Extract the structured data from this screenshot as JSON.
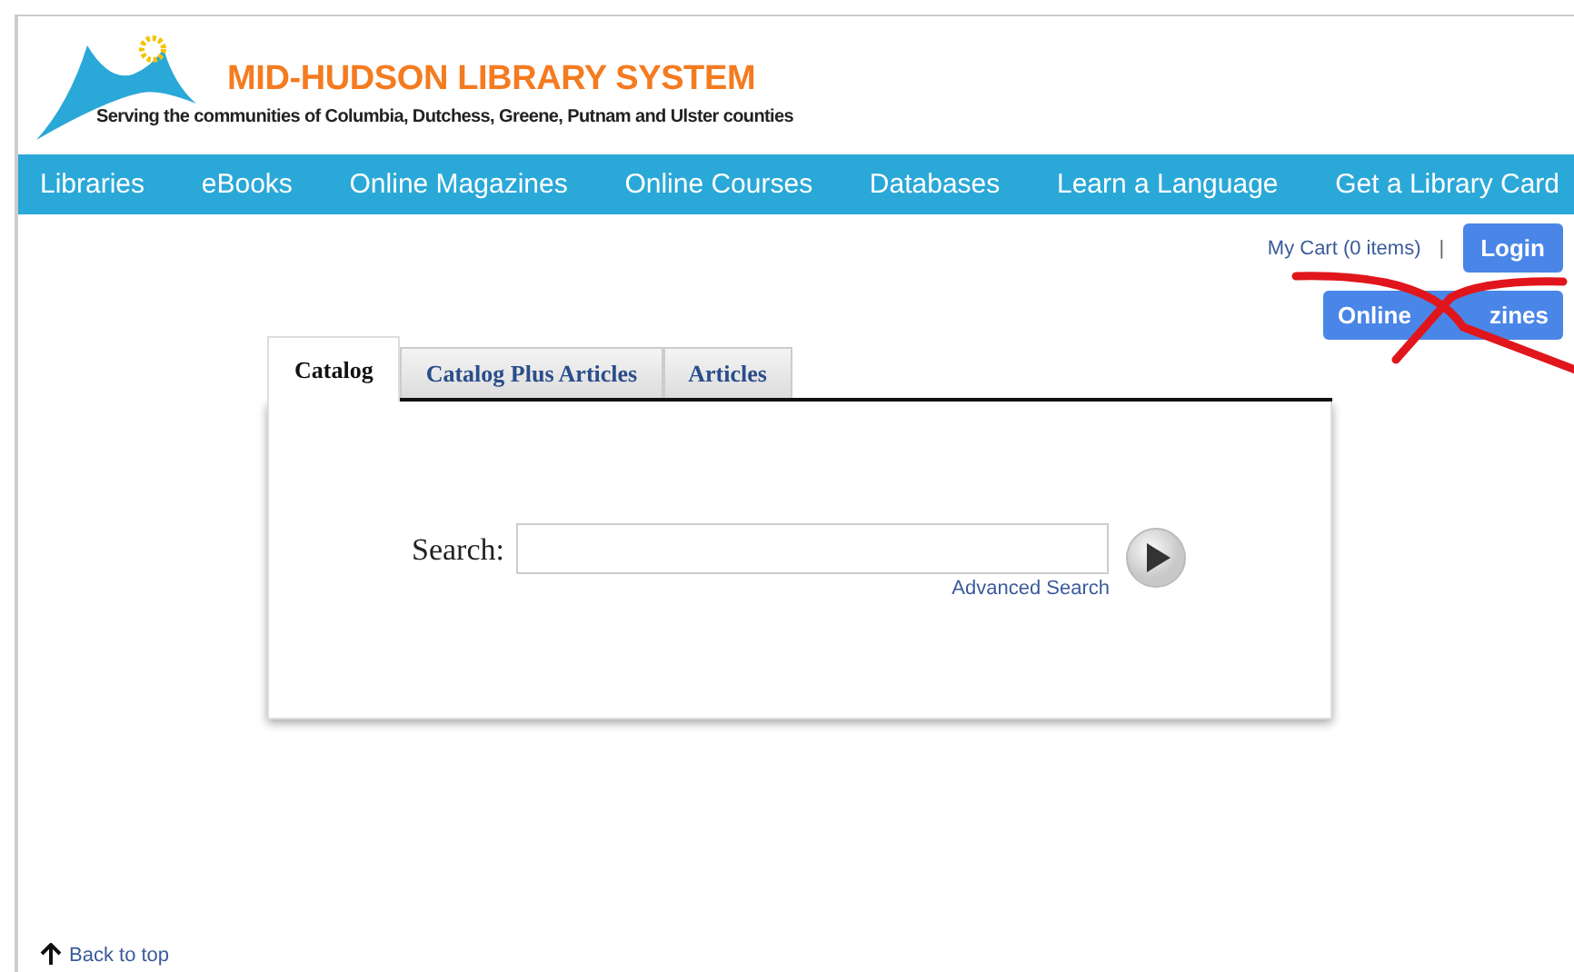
{
  "header": {
    "title": "MID-HUDSON LIBRARY SYSTEM",
    "tagline": "Serving the communities of Columbia, Dutchess, Greene, Putnam and Ulster counties"
  },
  "nav": [
    "Libraries",
    "eBooks",
    "Online Magazines",
    "Online Courses",
    "Databases",
    "Learn a Language",
    "Get a Library Card"
  ],
  "account": {
    "cart": "My Cart (0 items)",
    "separator": "|",
    "login": "Login",
    "feature_button": {
      "visible_start": "Online",
      "visible_end": "zines"
    }
  },
  "tabs": [
    {
      "label": "Catalog",
      "selected": true
    },
    {
      "label": "Catalog Plus Articles",
      "selected": false
    },
    {
      "label": "Articles",
      "selected": false
    }
  ],
  "search": {
    "label": "Search:",
    "advanced": "Advanced Search"
  },
  "footer": {
    "back_to_top": "Back to top"
  }
}
